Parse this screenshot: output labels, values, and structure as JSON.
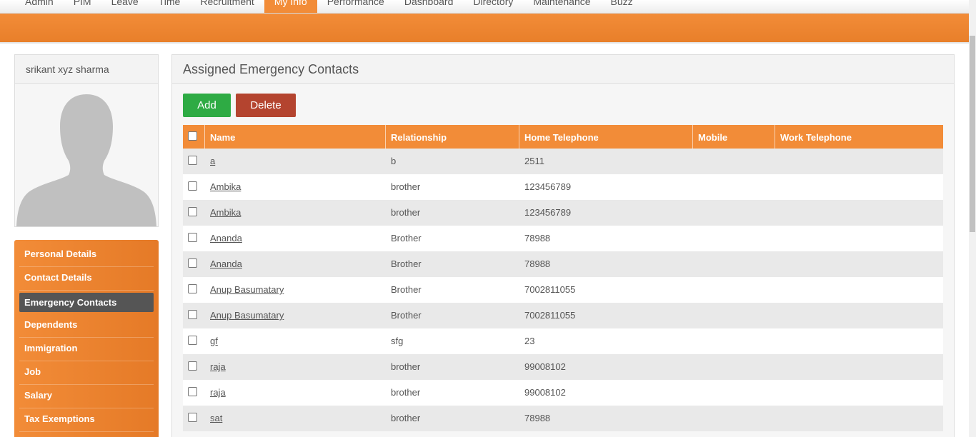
{
  "topnav": {
    "items": [
      "Admin",
      "PIM",
      "Leave",
      "Time",
      "Recruitment",
      "My Info",
      "Performance",
      "Dashboard",
      "Directory",
      "Maintenance",
      "Buzz"
    ],
    "active": "My Info"
  },
  "profile": {
    "name": "srikant xyz sharma"
  },
  "sidebar": {
    "items": [
      {
        "label": "Personal Details"
      },
      {
        "label": "Contact Details"
      },
      {
        "label": "Emergency Contacts"
      },
      {
        "label": "Dependents"
      },
      {
        "label": "Immigration"
      },
      {
        "label": "Job"
      },
      {
        "label": "Salary"
      },
      {
        "label": "Tax Exemptions"
      }
    ],
    "active": "Emergency Contacts"
  },
  "panel": {
    "title": "Assigned Emergency Contacts",
    "add_label": "Add",
    "delete_label": "Delete"
  },
  "table": {
    "columns": [
      "Name",
      "Relationship",
      "Home Telephone",
      "Mobile",
      "Work Telephone"
    ],
    "rows": [
      {
        "name": "a",
        "relationship": "b",
        "home": "2511",
        "mobile": "",
        "work": ""
      },
      {
        "name": "Ambika",
        "relationship": "brother",
        "home": "123456789",
        "mobile": "",
        "work": ""
      },
      {
        "name": "Ambika",
        "relationship": "brother",
        "home": "123456789",
        "mobile": "",
        "work": ""
      },
      {
        "name": "Ananda",
        "relationship": "Brother",
        "home": "78988",
        "mobile": "",
        "work": ""
      },
      {
        "name": "Ananda",
        "relationship": "Brother",
        "home": "78988",
        "mobile": "",
        "work": ""
      },
      {
        "name": "Anup Basumatary",
        "relationship": "Brother",
        "home": "7002811055",
        "mobile": "",
        "work": ""
      },
      {
        "name": "Anup Basumatary",
        "relationship": "Brother",
        "home": "7002811055",
        "mobile": "",
        "work": ""
      },
      {
        "name": "gf",
        "relationship": "sfg",
        "home": "23",
        "mobile": "",
        "work": ""
      },
      {
        "name": "raja",
        "relationship": "brother",
        "home": "99008102",
        "mobile": "",
        "work": ""
      },
      {
        "name": "raja",
        "relationship": "brother",
        "home": "99008102",
        "mobile": "",
        "work": ""
      },
      {
        "name": "sat",
        "relationship": "brother",
        "home": "78988",
        "mobile": "",
        "work": ""
      }
    ]
  },
  "colors": {
    "accent": "#f28c38",
    "add_button": "#2eab44",
    "delete_button": "#b4442f",
    "active_side": "#555555"
  },
  "icons": {
    "avatar": "avatar-silhouette-icon"
  }
}
